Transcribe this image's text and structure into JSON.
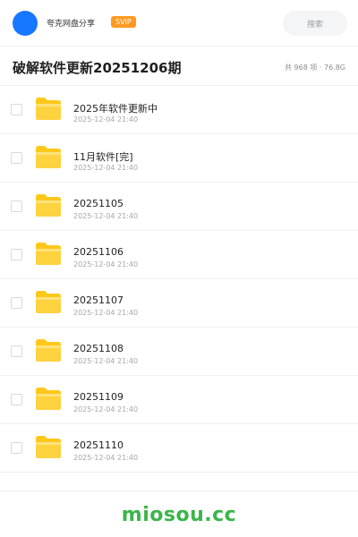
{
  "header": {
    "app_name": "夸克网盘分享",
    "badge": "SVIP",
    "search_placeholder": "搜索",
    "avatar_color": "#1677ff",
    "badge_color": "#ff9a1f"
  },
  "share": {
    "title": "破解软件更新20251206期",
    "meta": "共 968 项 · 76.8G"
  },
  "files": [
    {
      "name": "2025年软件更新中",
      "date": "2025-12-04 21:40",
      "icon": "folder-icon"
    },
    {
      "name": "11月软件[完]",
      "date": "2025-12-04 21:40",
      "icon": "folder-icon"
    },
    {
      "name": "20251105",
      "date": "2025-12-04 21:40",
      "icon": "folder-icon"
    },
    {
      "name": "20251106",
      "date": "2025-12-04 21:40",
      "icon": "folder-icon"
    },
    {
      "name": "20251107",
      "date": "2025-12-04 21:40",
      "icon": "folder-icon"
    },
    {
      "name": "20251108",
      "date": "2025-12-04 21:40",
      "icon": "folder-icon"
    },
    {
      "name": "20251109",
      "date": "2025-12-04 21:40",
      "icon": "folder-icon"
    },
    {
      "name": "20251110",
      "date": "2025-12-04 21:40",
      "icon": "folder-icon"
    }
  ],
  "footer": {
    "watermark": "miosou.cc",
    "watermark_color": "#3bb54a"
  }
}
